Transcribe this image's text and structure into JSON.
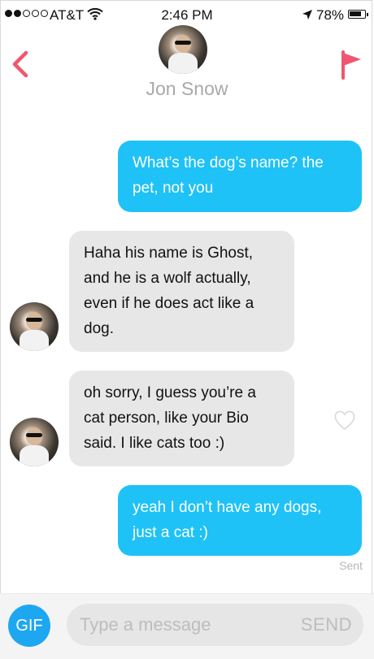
{
  "status_bar": {
    "carrier": "AT&T",
    "time": "2:46 PM",
    "battery": "78%",
    "battery_level": 0.78,
    "signal_bars_filled": 2,
    "signal_bars_total": 5,
    "icons": [
      "wifi-icon",
      "location-arrow-icon",
      "battery-icon"
    ]
  },
  "header": {
    "contact_name": "Jon Snow",
    "back_icon": "chevron-left-icon",
    "report_icon": "flag-icon"
  },
  "messages": [
    {
      "direction": "outgoing",
      "text": "What’s the dog’s name? the pet, not you"
    },
    {
      "direction": "incoming",
      "text": "Haha his name is Ghost, and he is a wolf actually, even if he does act like a dog."
    },
    {
      "direction": "incoming",
      "text": "oh sorry, I guess you’re a cat person, like your Bio said. I like cats too :)"
    },
    {
      "direction": "outgoing",
      "text": "yeah I don’t have any dogs, just a cat :)"
    }
  ],
  "receipt": "Sent",
  "composer": {
    "gif_label": "GIF",
    "placeholder": "Type a message",
    "send_label": "SEND"
  },
  "colors": {
    "accent_red": "#f0566f",
    "outgoing_bubble": "#1ec2f6",
    "incoming_bubble": "#e7e7e7",
    "gif_button": "#1ea7f1"
  }
}
